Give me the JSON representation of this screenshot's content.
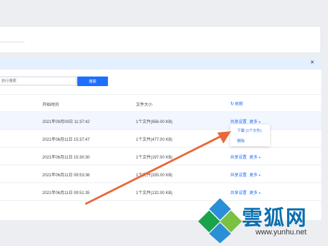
{
  "search": {
    "placeholder": "执行搜索",
    "button_label": "搜索"
  },
  "notice": {
    "close_label": "×"
  },
  "table": {
    "headers": {
      "start_time": "开始时间",
      "file_size": "文件大小"
    },
    "refresh_label": "刷新",
    "rows": [
      {
        "start_time": "2021年09月09日 11:37:42",
        "file_size": "1个文件(656.00 KB)",
        "share": "共享设置",
        "more": "更多"
      },
      {
        "start_time": "2021年06月11日 15:37:47",
        "file_size": "1个文件(477.00 KB)",
        "share": "",
        "more": ""
      },
      {
        "start_time": "2021年06月11日 15:30:30",
        "file_size": "1个文件(197.00 KB)",
        "share": "共享设置",
        "more": "更多"
      },
      {
        "start_time": "2021年06月11日 09:53:36",
        "file_size": "1个文件(335.00 KB)",
        "share": "共享设置",
        "more": "更多"
      },
      {
        "start_time": "2021年06月11日 09:51:35",
        "file_size": "1个文件(132.00 KB)",
        "share": "共享设置",
        "more": "更多"
      }
    ]
  },
  "dropdown": {
    "download": "下载 (1个文件)",
    "delete": "删除"
  },
  "watermark": {
    "text": "雲狐网",
    "url": "www.yunhu.net"
  },
  "colors": {
    "accent": "#1e6fff",
    "annotation_arrow": "#e8693a"
  },
  "icons": {
    "refresh": "refresh-icon",
    "caret": "caret-down-icon",
    "close": "close-icon"
  }
}
